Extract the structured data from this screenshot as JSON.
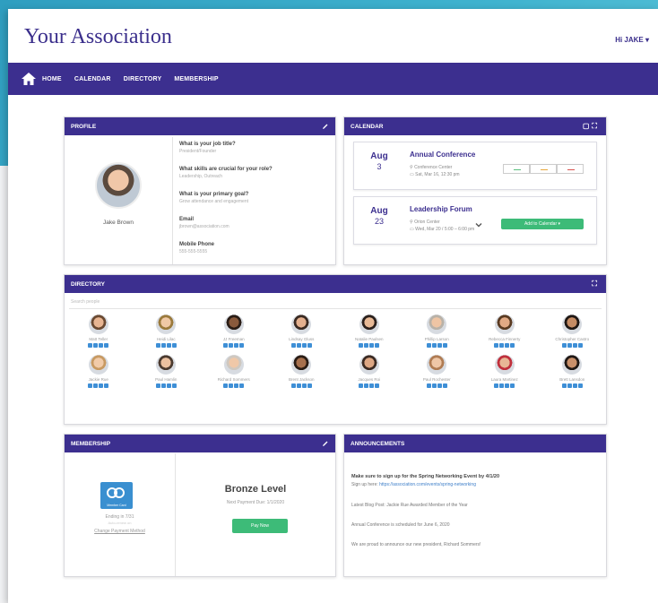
{
  "header": {
    "brand": "Your Association",
    "user_menu": "Hi JAKE ▾"
  },
  "nav": {
    "items": [
      "HOME",
      "CALENDAR",
      "DIRECTORY",
      "MEMBERSHIP"
    ]
  },
  "profile": {
    "title": "PROFILE",
    "name": "Jake Brown",
    "fields": [
      {
        "q": "What is your job title?",
        "a": "President/Founder"
      },
      {
        "q": "What skills are crucial for your role?",
        "a": "Leadership, Outreach"
      },
      {
        "q": "What is your primary goal?",
        "a": "Grow attendance and engagement"
      },
      {
        "q": "Email",
        "a": "jbrown@association.com"
      },
      {
        "q": "Mobile Phone",
        "a": "555-555-5555"
      }
    ]
  },
  "calendar": {
    "title": "CALENDAR",
    "events": [
      {
        "month": "Aug",
        "day": "3",
        "title": "Annual Conference",
        "location": "Conference Center",
        "time": "Sat, Mar 16, 12:30 pm"
      },
      {
        "month": "Aug",
        "day": "23",
        "title": "Leadership Forum",
        "location": "Orion Center",
        "time": "Wed, Mar 20 / 5:00 – 6:00 pm",
        "button": "Add to Calendar ▾"
      }
    ]
  },
  "directory": {
    "title": "DIRECTORY",
    "search_placeholder": "Search people",
    "people": [
      {
        "name": "Matt Teller",
        "skin": "#e8b592",
        "hair": "#6b4a32"
      },
      {
        "name": "Heidi Lilac",
        "skin": "#f0c9a6",
        "hair": "#9b7a3c"
      },
      {
        "name": "JJ Freeman",
        "skin": "#8a5a3c",
        "hair": "#2a1d16"
      },
      {
        "name": "Lindsay Gluss",
        "skin": "#e4b08e",
        "hair": "#3a2a22"
      },
      {
        "name": "Natalie Paulsen",
        "skin": "#e7b996",
        "hair": "#2b201c"
      },
      {
        "name": "Phillip Larson",
        "skin": "#efc5a4",
        "hair": "#b9b2a8"
      },
      {
        "name": "Rebecca Finnerty",
        "skin": "#e2aa85",
        "hair": "#5a3b22"
      },
      {
        "name": "Christopher Castro",
        "skin": "#c58c64",
        "hair": "#1f1713"
      },
      {
        "name": "Jackie Rue",
        "skin": "#f1cba9",
        "hair": "#c89a62"
      },
      {
        "name": "Paul Hamlin",
        "skin": "#ecc1a0",
        "hair": "#4b3a2f"
      },
      {
        "name": "Richard Sommers",
        "skin": "#f0c8a8",
        "hair": "#cfc8c0"
      },
      {
        "name": "Brent Jackson",
        "skin": "#a7704d",
        "hair": "#2a1c14"
      },
      {
        "name": "Jacques Roi",
        "skin": "#dca683",
        "hair": "#3b2a22"
      },
      {
        "name": "Paul Rochester",
        "skin": "#efc7a7",
        "hair": "#b07c53"
      },
      {
        "name": "Laura Martinez",
        "skin": "#e8b796",
        "hair": "#c0303c"
      },
      {
        "name": "Brett Lansdon",
        "skin": "#c9906a",
        "hair": "#201814"
      }
    ]
  },
  "membership": {
    "title": "MEMBERSHIP",
    "card_label": "Member Card",
    "status": "Ending in 7/31",
    "status_sub": "Auto-renew on",
    "link": "Change Payment Method",
    "level": "Bronze Level",
    "due": "Next Payment Due: 1/1/2020",
    "due_sub": "",
    "button": "Pay Now"
  },
  "announcements": {
    "title": "ANNOUNCEMENTS",
    "headline": "Make sure to sign up for the Spring Networking Event by 4/1/20",
    "signup_prefix": "Sign up here:",
    "signup_link": "https://association.com/events/spring-networking",
    "items": [
      "Latest Blog Post: Jackie Rue Awarded Member of the Year",
      "Annual Conference is scheduled for June 6, 2020",
      "We are proud to announce our new president, Richard Sommers!"
    ]
  },
  "colors": {
    "brand": "#3c2f8f",
    "accent_green": "#3dbb78",
    "link_blue": "#3e7fc9",
    "backdrop": "#3fb3cf"
  }
}
